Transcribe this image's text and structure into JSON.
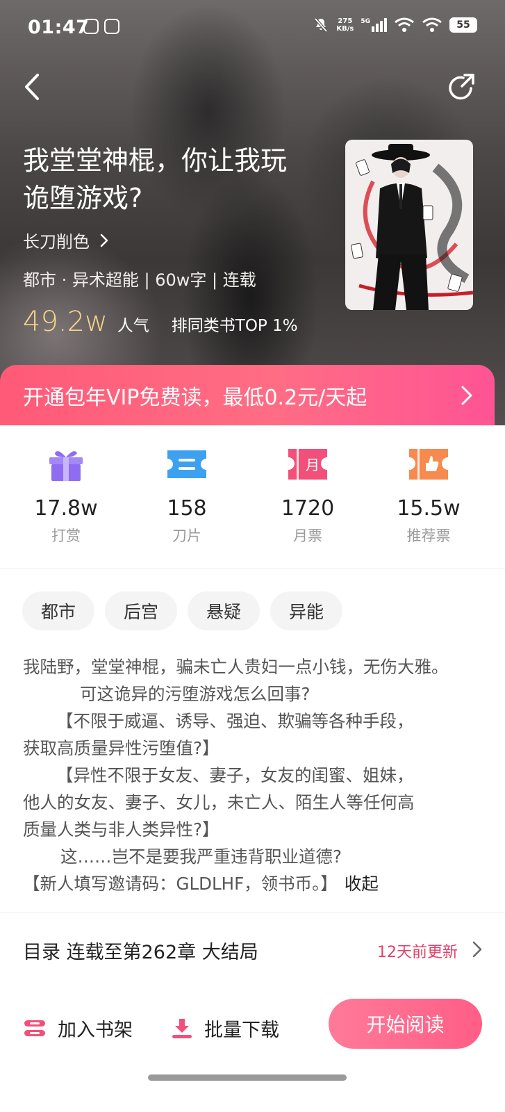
{
  "status_bar": {
    "time": "01:47",
    "net_speed_value": "275",
    "net_speed_unit": "KB/s",
    "network": "5G",
    "battery": "55"
  },
  "book": {
    "title_line1": "我堂堂神棍，你让我玩",
    "title_line2": "诡堕游戏?",
    "author": "长刀削色",
    "meta": "都市 · 异术超能 | 60w字 | 连载",
    "popularity_value": "49.2w",
    "popularity_label": "人气",
    "rank": "排同类书TOP 1%"
  },
  "vip_banner": {
    "text": "开通包年VIP免费读，最低0.2元/天起"
  },
  "stats": [
    {
      "value": "17.8w",
      "label": "打赏",
      "icon": "gift-icon",
      "color": "#8f6cf2"
    },
    {
      "value": "158",
      "label": "刀片",
      "icon": "blade-ticket-icon",
      "color": "#3ea1f0"
    },
    {
      "value": "1720",
      "label": "月票",
      "icon": "monthly-ticket-icon",
      "color": "#f2507a",
      "icon_text": "月"
    },
    {
      "value": "15.5w",
      "label": "推荐票",
      "icon": "recommend-ticket-icon",
      "color": "#f68a4f"
    }
  ],
  "tags": [
    "都市",
    "后宫",
    "悬疑",
    "异能"
  ],
  "synopsis": {
    "line1": "我陆野，堂堂神棍，骗未亡人贵妇一点小钱，无伤大雅。",
    "line2": "可这诡异的污堕游戏怎么回事?",
    "line3": "【不限于威逼、诱导、强迫、欺骗等各种手段，",
    "line4": "获取高质量异性污堕值?】",
    "line5": "【异性不限于女友、妻子，女友的闺蜜、姐妹，",
    "line6": "他人的女友、妻子、女儿，未亡人、陌生人等任何高",
    "line7": "质量人类与非人类异性?】",
    "line8": "这……岂不是要我严重违背职业道德?",
    "line9": "【新人填写邀请码：GLDLHF，领书币。】",
    "collapse": "收起"
  },
  "toc": {
    "title": "目录 连载至第262章 大结局",
    "update": "12天前更新"
  },
  "bottom_bar": {
    "shelf": "加入书架",
    "download": "批量下载",
    "read": "开始阅读"
  },
  "colors": {
    "accent_pink": "#ff5e86",
    "popularity_gold": "#f6d78a",
    "update_red": "#e5416a"
  }
}
